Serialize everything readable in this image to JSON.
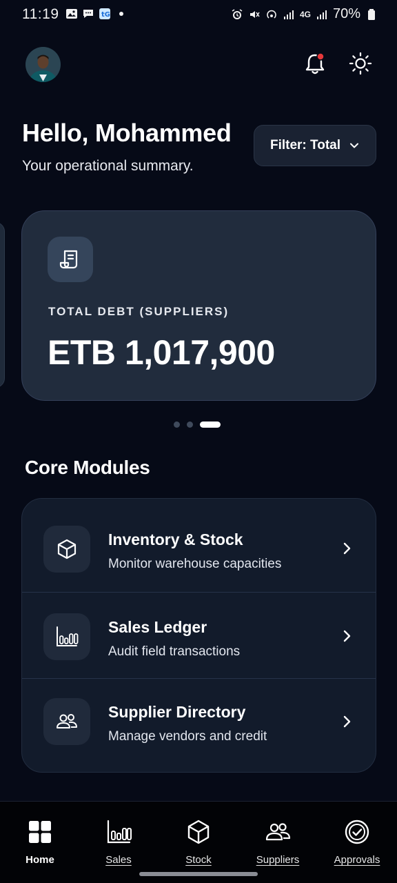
{
  "status_bar": {
    "time": "11:19",
    "network": "4G",
    "battery": "70%"
  },
  "header": {
    "avatar_alt": "user-avatar",
    "notification_badge_color": "#e5383b"
  },
  "greeting": {
    "title": "Hello, Mohammed",
    "subtitle": "Your operational summary."
  },
  "filter": {
    "label": "Filter: Total"
  },
  "summary_card": {
    "label": "TOTAL DEBT (SUPPLIERS)",
    "value": "ETB 1,017,900",
    "icon": "receipt-icon"
  },
  "carousel": {
    "total_slides": 3,
    "active_index": 2
  },
  "modules_section": {
    "title": "Core Modules",
    "items": [
      {
        "title": "Inventory & Stock",
        "description": "Monitor warehouse capacities",
        "icon": "box-icon"
      },
      {
        "title": "Sales Ledger",
        "description": "Audit field transactions",
        "icon": "bar-chart-icon"
      },
      {
        "title": "Supplier Directory",
        "description": "Manage vendors and credit",
        "icon": "users-icon"
      }
    ]
  },
  "bottom_nav": {
    "items": [
      {
        "label": "Home",
        "icon": "grid-icon",
        "active": true
      },
      {
        "label": "Sales",
        "icon": "bar-chart-icon",
        "active": false
      },
      {
        "label": "Stock",
        "icon": "box-icon",
        "active": false
      },
      {
        "label": "Suppliers",
        "icon": "users-icon",
        "active": false
      },
      {
        "label": "Approvals",
        "icon": "check-circle-icon",
        "active": false
      }
    ]
  },
  "colors": {
    "background": "#060a17",
    "card": "#212c3d",
    "module_panel": "#121b2b",
    "accent_red": "#e5383b"
  }
}
